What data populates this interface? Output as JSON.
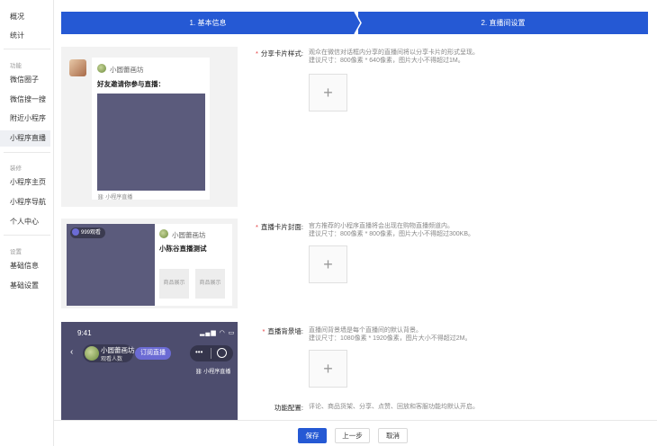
{
  "sidebar": {
    "items": [
      {
        "label": "概况"
      },
      {
        "label": "统计"
      }
    ],
    "group_function": "功能",
    "function_items": [
      {
        "label": "微信圈子"
      },
      {
        "label": "微信搜一搜"
      },
      {
        "label": "附近小程序"
      },
      {
        "label": "小程序直播"
      }
    ],
    "group_decor": "装修",
    "decor_items": [
      {
        "label": "小程序主页"
      },
      {
        "label": "小程序导航"
      },
      {
        "label": "个人中心"
      }
    ],
    "group_settings": "设置",
    "settings_items": [
      {
        "label": "基础信息"
      },
      {
        "label": "基础设置"
      }
    ]
  },
  "steps": {
    "step1": "1. 基本信息",
    "step2": "2. 直播间设置"
  },
  "preview1": {
    "shop_name": "小圆蕾画坊",
    "invite_text": "好友邀请你参与直播：",
    "footer_tag": "小程序直播"
  },
  "preview2": {
    "viewers_badge": "999观看",
    "shop_name": "小圆蕾画坊",
    "room_title": "小陈谷直播测试",
    "product1": "商品展示",
    "product2": "商品展示"
  },
  "preview3": {
    "time": "9:41",
    "shop_name": "小圆蕾画坊",
    "viewers": "观看人数",
    "subscribe": "订阅直播",
    "tag": "小程序直播"
  },
  "form": {
    "share_card": {
      "label": "分享卡片样式:",
      "desc1": "观众在微信对话框内分享的直播间将以分享卡片的形式呈现。",
      "desc2": "建议尺寸：800像素 * 640像素，图片大小不得超过1M。"
    },
    "cover": {
      "label": "直播卡片封面:",
      "desc1": "官方推荐的小程序直播将会出现在购物直播频道内。",
      "desc2": "建议尺寸：800像素 * 800像素，图片大小不得超过300KB。"
    },
    "background": {
      "label": "直播背景墙:",
      "desc1": "直播间背景墙是每个直播间的默认背景。",
      "desc2": "建议尺寸：1080像素 * 1920像素，图片大小不得超过2M。"
    },
    "features": {
      "label": "功能配置:",
      "desc": "评论、商品货架、分享、点赞、回放和客服功能均默认开启。"
    },
    "upload_symbol": "+"
  },
  "footer": {
    "save": "保存",
    "prev": "上一步",
    "cancel": "取消"
  },
  "colors": {
    "primary": "#2559d4",
    "required": "#e4393c",
    "cover": "#5b5b7c"
  }
}
